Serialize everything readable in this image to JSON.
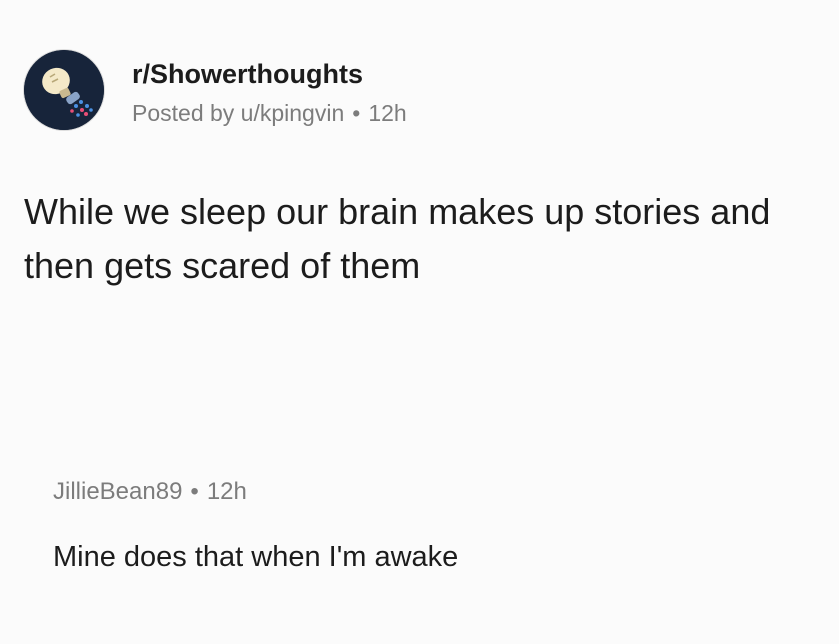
{
  "post": {
    "subreddit": "r/Showerthoughts",
    "posted_by": "Posted by u/kpingvin",
    "separator": "•",
    "time": "12h",
    "title": "While we sleep our brain makes up stories and then gets scared of them",
    "avatar_icon": "lightbulb-shower-icon",
    "avatar_color": "#17243a"
  },
  "comment": {
    "author": "JillieBean89",
    "separator": "•",
    "time": "12h",
    "body": "Mine does that when I'm awake"
  }
}
